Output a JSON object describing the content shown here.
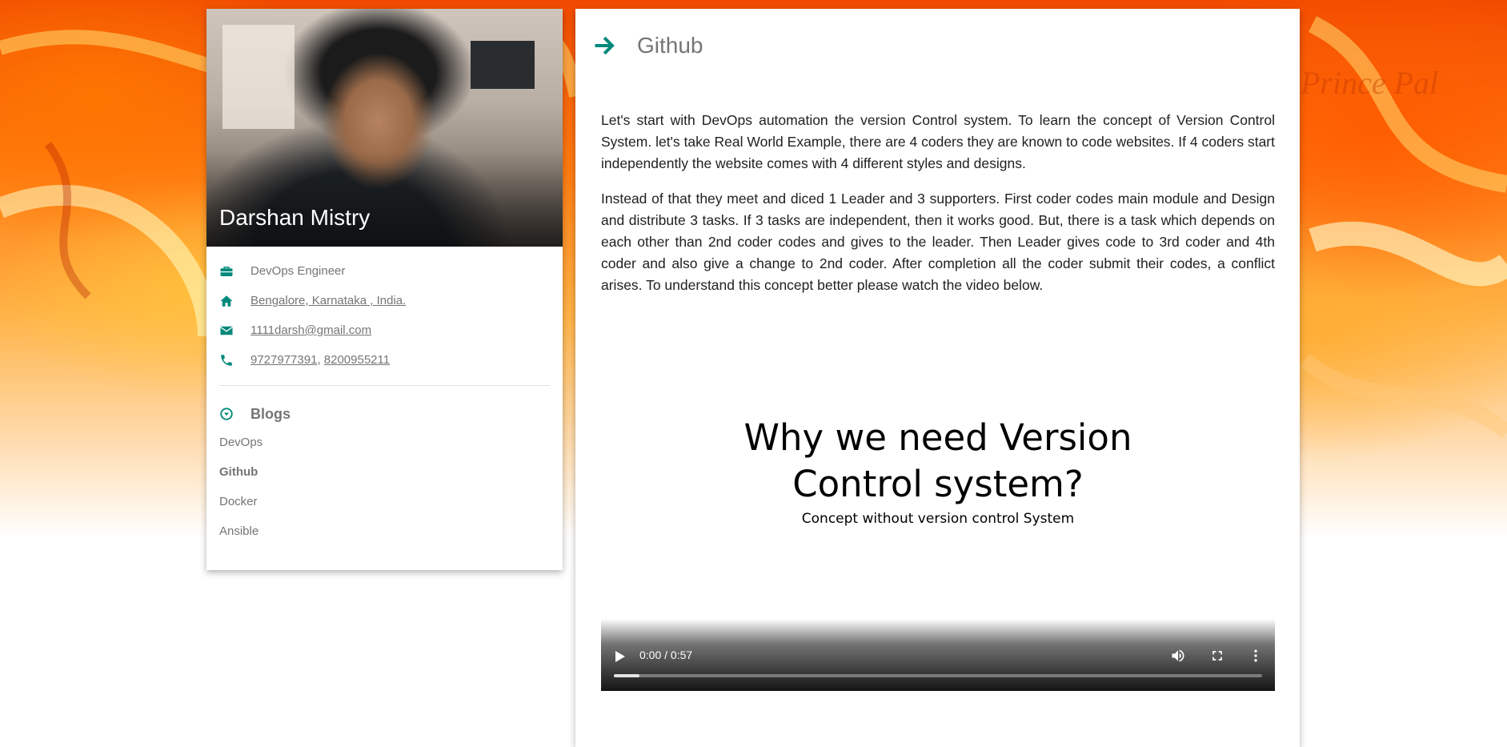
{
  "background": {
    "watermark": "Prince Pal"
  },
  "profile": {
    "name": "Darshan Mistry",
    "role": "DevOps Engineer",
    "location": "Bengalore, Karnataka , India.",
    "email": "1111darsh@gmail.com",
    "phones": [
      "9727977391",
      "8200955211"
    ],
    "phone_separator": ","
  },
  "blogs": {
    "title": "Blogs",
    "items": [
      {
        "label": "DevOps",
        "active": false
      },
      {
        "label": "Github",
        "active": true
      },
      {
        "label": "Docker",
        "active": false
      },
      {
        "label": "Ansible",
        "active": false
      }
    ]
  },
  "article": {
    "title": "Github",
    "paragraphs": [
      "Let's start with DevOps automation the version Control system. To learn the concept of Version Control System. let's take Real World Example, there are 4 coders they are known to code websites. If 4 coders start independently the website comes with 4 different styles and designs.",
      "Instead of that they meet and diced 1 Leader and 3 supporters. First coder codes main module and Design and distribute 3 tasks. If 3 tasks are independent, then it works good. But, there is a task which depends on each other than 2nd coder codes and gives to the leader. Then Leader gives code to 3rd coder and 4th coder and also give a change to 2nd coder. After completion all the coder submit their codes, a conflict arises. To understand this concept better please watch the video below."
    ]
  },
  "video": {
    "slide_title_line1": "Why we need Version",
    "slide_title_line2": "Control system?",
    "slide_subtitle": "Concept without version control System",
    "time": "0:00 / 0:57",
    "buffered_fraction": 0.04
  },
  "colors": {
    "accent": "#00897b",
    "text_muted": "#757575",
    "text_body": "#212121"
  },
  "icons": {
    "role": "briefcase-icon",
    "location": "home-icon",
    "email": "envelope-icon",
    "phone": "phone-icon",
    "blogs": "circle-down-icon",
    "header": "arrow-right-icon",
    "play": "play-icon",
    "volume": "volume-icon",
    "fullscreen": "fullscreen-icon",
    "more": "more-vertical-icon"
  }
}
